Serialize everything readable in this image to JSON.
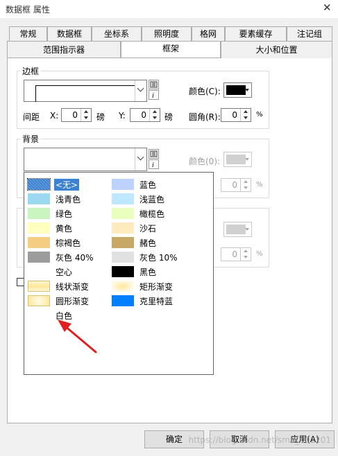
{
  "window": {
    "title": "数据框 属性",
    "close": "✕"
  },
  "tabs_row1": [
    "常规",
    "数据框",
    "坐标系",
    "照明度",
    "格网",
    "要素缓存",
    "注记组"
  ],
  "tabs_row2": [
    "范围指示器",
    "框架",
    "大小和位置"
  ],
  "active_tab": "框架",
  "border": {
    "label": "边框",
    "color_label": "颜色(C):",
    "color": "#000000",
    "spacing_label": "间距",
    "x_label": "X:",
    "x_value": "0",
    "x_unit": "磅",
    "y_label": "Y:",
    "y_value": "0",
    "y_unit": "磅",
    "corner_label": "圆角(R):",
    "corner_value": "0",
    "corner_unit": "%"
  },
  "background": {
    "label": "背景",
    "color_label": "颜色(0):",
    "y_value": "0",
    "corner_value": "0",
    "corner_unit": "%"
  },
  "shadow": {
    "corner_value": "0",
    "corner_unit": "%"
  },
  "dropdown_items": [
    {
      "label": "<无>",
      "color": "#ffffff",
      "selected": true
    },
    {
      "label": "浅青色",
      "color": "#9ad9f0"
    },
    {
      "label": "绿色",
      "color": "#c8f5c0"
    },
    {
      "label": "黄色",
      "color": "#ffffbe"
    },
    {
      "label": "棕褐色",
      "color": "#f5cd82"
    },
    {
      "label": "灰色 40%",
      "color": "#9c9c9c"
    },
    {
      "label": "空心",
      "color": ""
    },
    {
      "label": "线状渐变",
      "color": "#fff1b0"
    },
    {
      "label": "圆形渐变",
      "color": "#fff1b0"
    },
    {
      "label": "白色",
      "color": ""
    },
    {
      "label": "蓝色",
      "color": "#bed2ff"
    },
    {
      "label": "浅蓝色",
      "color": "#bee8ff"
    },
    {
      "label": "橄榄色",
      "color": "#e8ffbe"
    },
    {
      "label": "沙石",
      "color": "#ffebbe"
    },
    {
      "label": "赭色",
      "color": "#c8a865"
    },
    {
      "label": "灰色 10%",
      "color": "#e1e1e1"
    },
    {
      "label": "黑色",
      "color": "#000000"
    },
    {
      "label": "矩形渐变",
      "color": "#fff1b0"
    },
    {
      "label": "克里特蓝",
      "color": "#0080ff"
    }
  ],
  "buttons": {
    "ok": "确定",
    "cancel": "取消",
    "apply": "应用(A)"
  },
  "watermark": "https://blog.csdn.net/sma_001201",
  "accent": {
    "arrow": "#e02020",
    "selection": "#3c82d2"
  }
}
